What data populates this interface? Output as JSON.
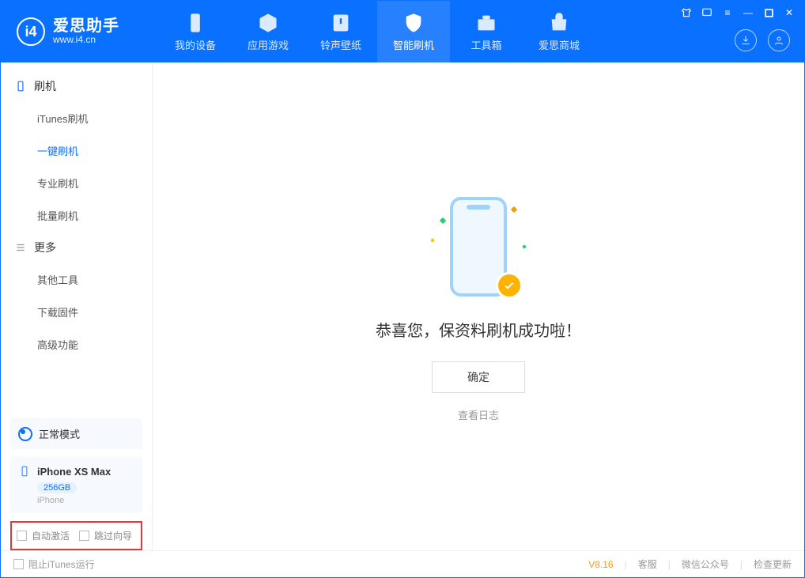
{
  "app": {
    "logo_title": "爱思助手",
    "logo_sub": "www.i4.cn"
  },
  "nav": [
    {
      "label": "我的设备"
    },
    {
      "label": "应用游戏"
    },
    {
      "label": "铃声壁纸"
    },
    {
      "label": "智能刷机"
    },
    {
      "label": "工具箱"
    },
    {
      "label": "爱思商城"
    }
  ],
  "sidebar": {
    "group1_title": "刷机",
    "group1_items": [
      "iTunes刷机",
      "一键刷机",
      "专业刷机",
      "批量刷机"
    ],
    "group2_title": "更多",
    "group2_items": [
      "其他工具",
      "下载固件",
      "高级功能"
    ]
  },
  "status": {
    "mode": "正常模式"
  },
  "device": {
    "name": "iPhone XS Max",
    "storage": "256GB",
    "type": "iPhone"
  },
  "options": {
    "auto_activate": "自动激活",
    "skip_guide": "跳过向导"
  },
  "main": {
    "success": "恭喜您，保资料刷机成功啦！",
    "ok": "确定",
    "view_log": "查看日志"
  },
  "footer": {
    "block_itunes": "阻止iTunes运行",
    "version": "V8.16",
    "service": "客服",
    "wechat": "微信公众号",
    "update": "检查更新"
  }
}
